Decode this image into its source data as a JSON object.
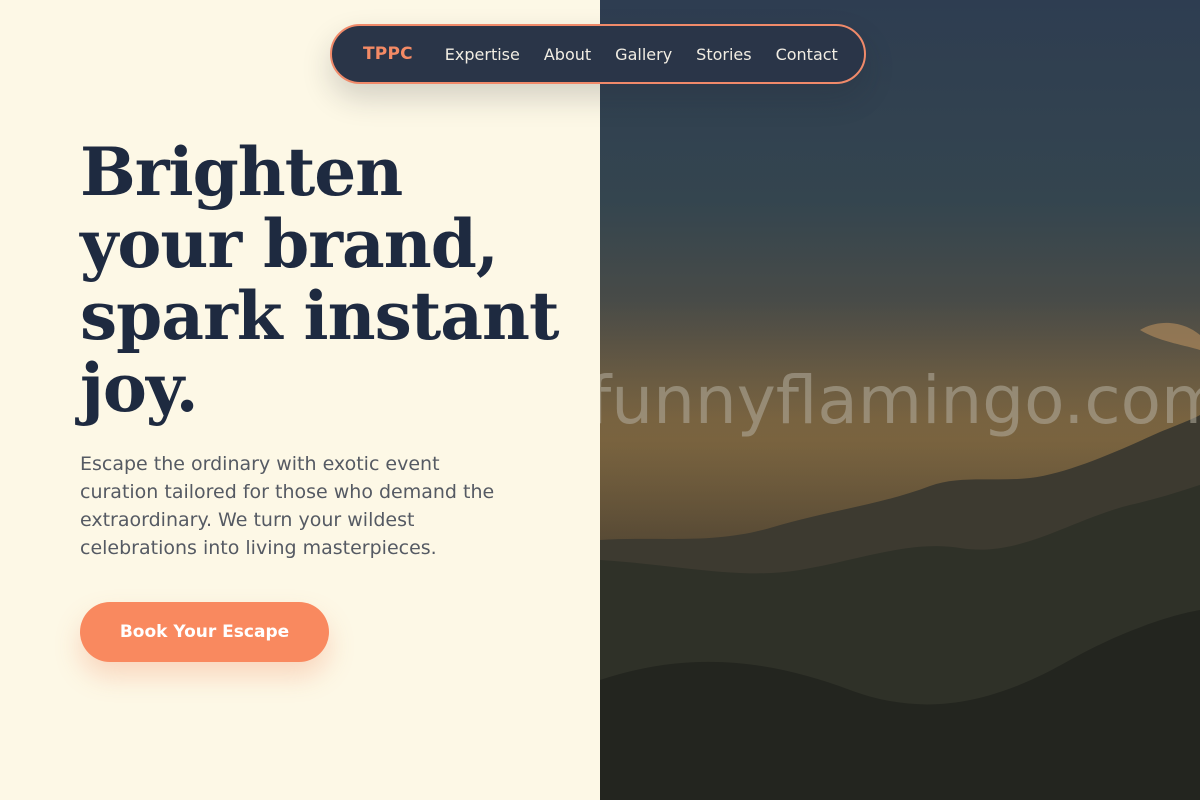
{
  "nav": {
    "logo": "TPPC",
    "links": [
      "Expertise",
      "About",
      "Gallery",
      "Stories",
      "Contact"
    ]
  },
  "hero": {
    "headline_lines": [
      "Brighten",
      "your brand,",
      "spark instant",
      "joy."
    ],
    "description_lines": [
      "Escape the ordinary with exotic event",
      "curation tailored for those who demand the",
      "extraordinary. We turn your wildest",
      "celebrations into living masterpieces."
    ],
    "cta_label": "Book Your Escape"
  },
  "image": {
    "watermark": "funnyflamingo.com"
  },
  "colors": {
    "background": "#fdf8e6",
    "nav_background": "#2a3548",
    "accent": "#f9895f",
    "headline": "#1e2a40",
    "body_text": "#555a63"
  }
}
